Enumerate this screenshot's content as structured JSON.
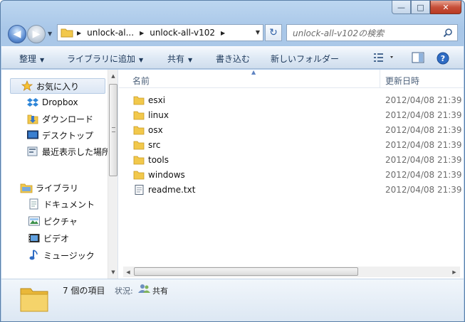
{
  "window": {
    "caption_buttons": {
      "minimize": "—",
      "maximize": "□",
      "close": "✕"
    }
  },
  "navigation": {
    "back_icon": "back-arrow-icon",
    "forward_icon": "forward-arrow-icon",
    "back_glyph": "◀",
    "forward_glyph": "▶"
  },
  "address": {
    "breadcrumbs": [
      "unlock-al...",
      "unlock-all-v102"
    ],
    "separator": "▶",
    "dropdown": "▼"
  },
  "refresh": {
    "glyph": "↻"
  },
  "search": {
    "placeholder": "unlock-all-v102の検索"
  },
  "toolbar": {
    "organize": "整理",
    "add_to_library": "ライブラリに追加",
    "share": "共有",
    "burn": "書き込む",
    "new_folder": "新しいフォルダー",
    "arrow": "▼"
  },
  "sidebar": {
    "favorites": "お気に入り",
    "items": [
      {
        "label": "Dropbox",
        "icon": "dropbox-icon"
      },
      {
        "label": "ダウンロード",
        "icon": "downloads-icon"
      },
      {
        "label": "デスクトップ",
        "icon": "desktop-icon"
      },
      {
        "label": "最近表示した場所",
        "icon": "recent-places-icon"
      }
    ],
    "libraries": "ライブラリ",
    "library_items": [
      {
        "label": "ドキュメント",
        "icon": "documents-icon"
      },
      {
        "label": "ピクチャ",
        "icon": "pictures-icon"
      },
      {
        "label": "ビデオ",
        "icon": "videos-icon"
      },
      {
        "label": "ミュージック",
        "icon": "music-icon"
      }
    ]
  },
  "file_list": {
    "columns": {
      "name": "名前",
      "modified": "更新日時"
    },
    "files": [
      {
        "name": "esxi",
        "date": "2012/04/08 21:39",
        "type": "folder"
      },
      {
        "name": "linux",
        "date": "2012/04/08 21:39",
        "type": "folder"
      },
      {
        "name": "osx",
        "date": "2012/04/08 21:39",
        "type": "folder"
      },
      {
        "name": "src",
        "date": "2012/04/08 21:39",
        "type": "folder"
      },
      {
        "name": "tools",
        "date": "2012/04/08 21:39",
        "type": "folder"
      },
      {
        "name": "windows",
        "date": "2012/04/08 21:39",
        "type": "folder"
      },
      {
        "name": "readme.txt",
        "date": "2012/04/08 21:39",
        "type": "text"
      }
    ]
  },
  "details": {
    "item_count": "7 個の項目",
    "status_label": "状況:",
    "share_state": "共有"
  },
  "colors": {
    "folder": "#f2c84b",
    "accent": "#2e5fa6"
  }
}
